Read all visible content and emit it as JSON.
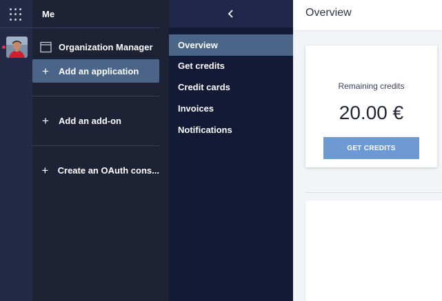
{
  "header": {
    "section_title": "Me"
  },
  "organization": {
    "name": "Organization Manager",
    "items": [
      {
        "label": "Add an application"
      },
      {
        "label": "Add an add-on"
      },
      {
        "label": "Create an OAuth cons..."
      }
    ]
  },
  "subnav": {
    "items": [
      {
        "label": "Overview"
      },
      {
        "label": "Get credits"
      },
      {
        "label": "Credit cards"
      },
      {
        "label": "Invoices"
      },
      {
        "label": "Notifications"
      }
    ]
  },
  "main": {
    "title": "Overview",
    "credits_card": {
      "label": "Remaining credits",
      "value": "20.00 €",
      "button_label": "GET CREDITS"
    }
  },
  "colors": {
    "rail_bg": "#242a45",
    "org_panel_bg": "#1e2235",
    "subnav_bg": "#131a35",
    "active_item_bg": "#4a6588",
    "primary_button": "#6d9ad3"
  }
}
